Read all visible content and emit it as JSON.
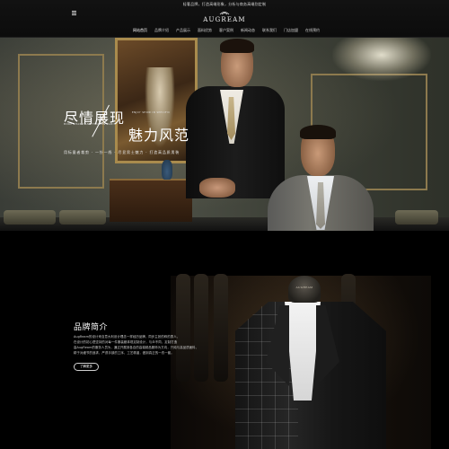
{
  "header": {
    "notice": "轻奢品牌，打造高端形象，分析与商务高端别定制",
    "brand_name": "AUGREAM",
    "nav": [
      {
        "label": "网站首页",
        "active": true
      },
      {
        "label": "品牌介绍",
        "active": false
      },
      {
        "label": "产品展示",
        "active": false
      },
      {
        "label": "面料优势",
        "active": false
      },
      {
        "label": "客户案例",
        "active": false
      },
      {
        "label": "新闻动态",
        "active": false
      },
      {
        "label": "联系我们",
        "active": false
      },
      {
        "label": "门店加盟",
        "active": false
      },
      {
        "label": "在线预约",
        "active": false
      }
    ]
  },
  "hero": {
    "slogan_line1": "尽情展现",
    "slogan_line2": "魅力风范",
    "slogan_en_1": "ENJOY SHOW IN SPECIFIC",
    "slogan_en_2": "MORE CHARM AND FASHION HABIT",
    "tagline": "用标量者裁剪 · 一针一线 · 尽显男士魅力 · 打造高品质男装"
  },
  "intro": {
    "title": "品牌简介",
    "body": [
      "AugReam的设计来自意大利设计理念一样经历品牌，同步主张的称的男人，",
      "在设计的初心是坚持的对每一件服装都体现定制设计，与众不同，定制打造",
      "高AugReam的服务人员为，通过开展到各自的高端精品服饰为方向，只纯与高品质面料，",
      "精于对细节的追求，严谨手部的工序，工艺精湛，做到真正的一衣一套。"
    ],
    "more_label": "了解更多",
    "mannequin_label": "AUGREAM"
  }
}
